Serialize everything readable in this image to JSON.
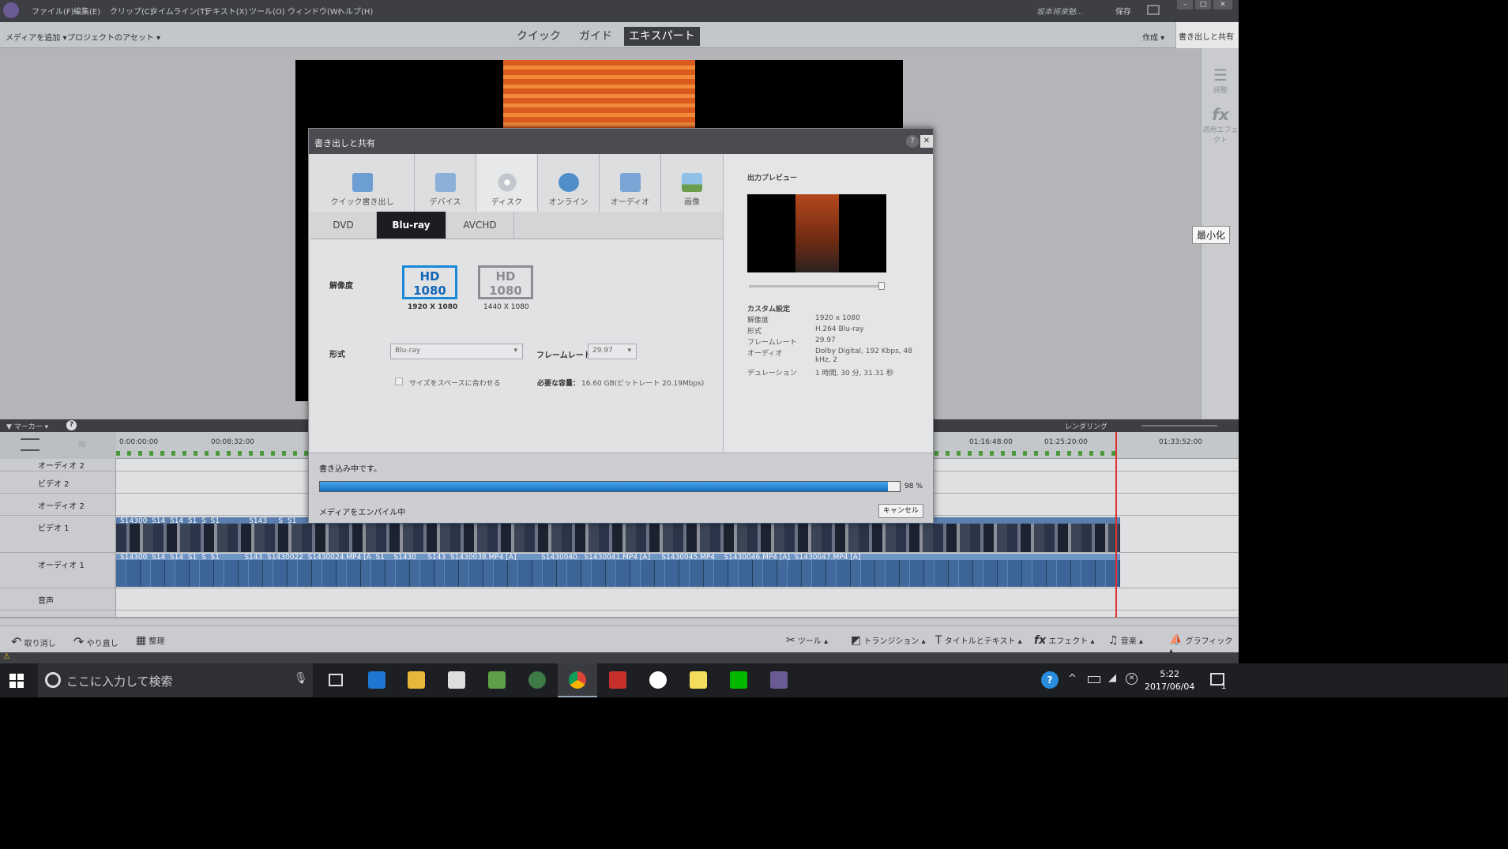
{
  "menubar": {
    "items": [
      "ファイル(F)",
      "編集(E)",
      "クリップ(C)",
      "タイムライン(T)",
      "テキスト(X)",
      "ツール(O)",
      "ウィンドウ(W)",
      "ヘルプ(H)"
    ],
    "user": "坂本将來魅...",
    "save": "保存"
  },
  "toolbar": {
    "add_media": "メディアを追加",
    "project_assets": "プロジェクトのアセット",
    "modes": [
      "クイック",
      "ガイド",
      "エキスパート"
    ],
    "active_mode": "エキスパート",
    "create": "作成",
    "export_share": "書き出しと共有"
  },
  "right_panel": {
    "adjust": "調整",
    "applied_effects": "適用エフェクト",
    "tooltip": "最小化"
  },
  "timeline": {
    "marker": "マーカー",
    "rendering": "レンダリング",
    "ticks": [
      "0:00:00:00",
      "00:08:32:00",
      "01:16:48:00",
      "01:25:20:00",
      "01:33:52:00"
    ],
    "tracks": [
      "オーディオ 2",
      "ビデオ 2",
      "オーディオ 2",
      "ビデオ 1",
      "オーディオ 1",
      "音声"
    ],
    "clip_labels_video": [
      "S14300",
      "S14",
      "S14",
      "S1",
      "S",
      "S1",
      "S143",
      "S",
      "S1"
    ],
    "clip_labels_audio": [
      "S14300",
      "S14",
      "S14",
      "S1",
      "S",
      "S1",
      "S143",
      "S1430022",
      "S1430024.MP4 [A",
      "S1",
      "S1430",
      "S143",
      "S1430038.MP4 [A]",
      "S1430040.",
      "S1430041.MP4 [A]",
      "S1430045.MP4",
      "S1430046.MP4 [A]",
      "S1430047.MP4 [A]"
    ]
  },
  "bottombar": {
    "undo": "取り消し",
    "redo": "やり直し",
    "organize": "整理",
    "tools": "ツール",
    "transitions": "トランジション",
    "titles": "タイトルとテキスト",
    "effects": "エフェクト",
    "music": "音楽",
    "graphics": "グラフィック"
  },
  "dialog": {
    "title": "書き出しと共有",
    "categories": [
      "クイック書き出し",
      "デバイス",
      "ディスク",
      "オンライン",
      "オーディオ",
      "画像"
    ],
    "active_category": "ディスク",
    "subtabs": [
      "DVD",
      "Blu-ray",
      "AVCHD"
    ],
    "active_subtab": "Blu-ray",
    "resolution_label": "解像度",
    "res_options": [
      {
        "hd": "HD",
        "num": "1080",
        "caption": "1920 X 1080",
        "selected": true
      },
      {
        "hd": "HD",
        "num": "1080",
        "caption": "1440 X 1080",
        "selected": false
      }
    ],
    "format_label": "形式",
    "format_value": "Blu-ray",
    "framerate_label": "フレームレート",
    "framerate_value": "29.97",
    "fit_checkbox": "サイズをスペースに合わせる",
    "required_capacity_label": "必要な容量：",
    "required_capacity_value": "16.60 GB(ビットレート 20.19Mbps)",
    "preview_label": "出力プレビュー",
    "custom_settings_label": "カスタム設定",
    "settings": [
      {
        "k": "解像度",
        "v": "1920 x 1080"
      },
      {
        "k": "形式",
        "v": "H.264 Blu-ray"
      },
      {
        "k": "フレームレート",
        "v": "29.97"
      },
      {
        "k": "オーディオ",
        "v": "Dolby Digital, 192 Kbps, 48 kHz, 2"
      },
      {
        "k": "デュレーション",
        "v": "1 時間, 30 分, 31.31 秒"
      }
    ],
    "status": "書き込み中です。",
    "progress_percent": 98,
    "progress_text": "98 %",
    "substatus": "メディアをエンパイル中",
    "cancel": "キャンセル"
  },
  "taskbar": {
    "search_placeholder": "ここに入力して検索",
    "time": "5:22",
    "date": "2017/06/04",
    "notifications": "1"
  },
  "colors": {
    "accent": "#1789d8",
    "progress": "#1670c4",
    "dark": "#3d3f45"
  }
}
